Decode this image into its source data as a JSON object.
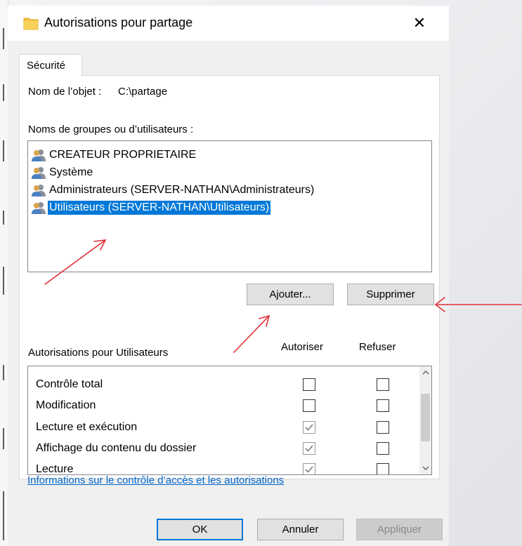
{
  "window": {
    "title": "Autorisations pour partage",
    "close_symbol": "✕"
  },
  "tab": {
    "label": "Sécurité"
  },
  "object": {
    "label": "Nom de l’objet :",
    "value": "C:\\partage"
  },
  "groups_label": "Noms de groupes ou d’utilisateurs :",
  "users": [
    {
      "name": "CREATEUR PROPRIETAIRE",
      "icon": "users-group-icon",
      "selected": false
    },
    {
      "name": "Système",
      "icon": "users-group-icon",
      "selected": false
    },
    {
      "name": "Administrateurs (SERVER-NATHAN\\Administrateurs)",
      "icon": "users-group-icon",
      "selected": false
    },
    {
      "name": "Utilisateurs (SERVER-NATHAN\\Utilisateurs)",
      "icon": "users-group-icon",
      "selected": true
    }
  ],
  "buttons": {
    "add": "Ajouter...",
    "remove": "Supprimer",
    "ok": "OK",
    "cancel": "Annuler",
    "apply": "Appliquer"
  },
  "permissions": {
    "title": "Autorisations pour Utilisateurs",
    "allow_header": "Autoriser",
    "deny_header": "Refuser",
    "rows": [
      {
        "name": "Contrôle total",
        "allow": false,
        "deny": false
      },
      {
        "name": "Modification",
        "allow": false,
        "deny": false
      },
      {
        "name": "Lecture et exécution",
        "allow": true,
        "deny": false
      },
      {
        "name": "Affichage du contenu du dossier",
        "allow": true,
        "deny": false
      },
      {
        "name": "Lecture",
        "allow": true,
        "deny": false
      }
    ]
  },
  "info_link": "Informations sur le contrôle d’accès et les autorisations",
  "colors": {
    "selection": "#0078d7",
    "link": "#0066cc",
    "annotation_arrow": "#e0303a",
    "folder": "#f5c443"
  }
}
